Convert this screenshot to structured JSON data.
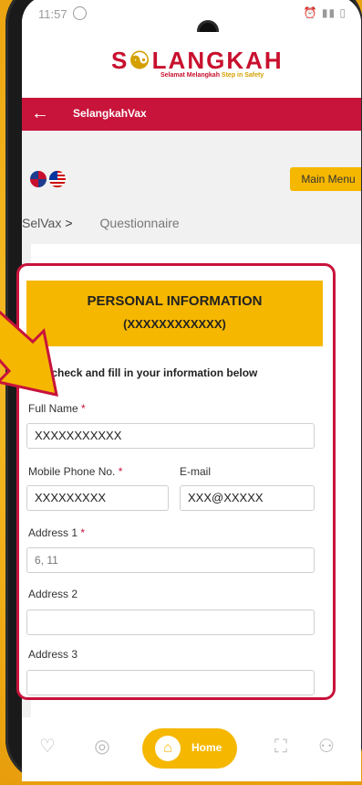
{
  "status_bar": {
    "time": "11:57"
  },
  "logo": {
    "brand_left": "S",
    "brand_right": "LANGKAH",
    "tagline_red": "Selamat Melangkah",
    "tagline_gold": "Step in Safety"
  },
  "header": {
    "title": "SelangkahVax"
  },
  "toolbar": {
    "main_menu_label": "Main Menu"
  },
  "breadcrumb": {
    "item1": "SelVax",
    "separator": ">",
    "item2": "Questionnaire"
  },
  "form": {
    "section_title": "PERSONAL INFORMATION",
    "section_subtitle": "(XXXXXXXXXXXX)",
    "instruction": "ase check and fill in your information below",
    "full_name_label": "Full Name",
    "full_name_value": "XXXXXXXXXXX",
    "mobile_label": "Mobile Phone No.",
    "mobile_value": "XXXXXXXXX",
    "email_label": "E-mail",
    "email_value": "XXX@XXXXX",
    "address1_label": "Address 1",
    "address1_value": "6, 11",
    "address2_label": "Address 2",
    "address2_value": "",
    "address3_label": "Address 3",
    "required_mark": "*"
  },
  "nav": {
    "home_label": "Home"
  },
  "colors": {
    "brand_red": "#c8133b",
    "brand_yellow": "#f5b700",
    "background": "#f3b41a"
  }
}
